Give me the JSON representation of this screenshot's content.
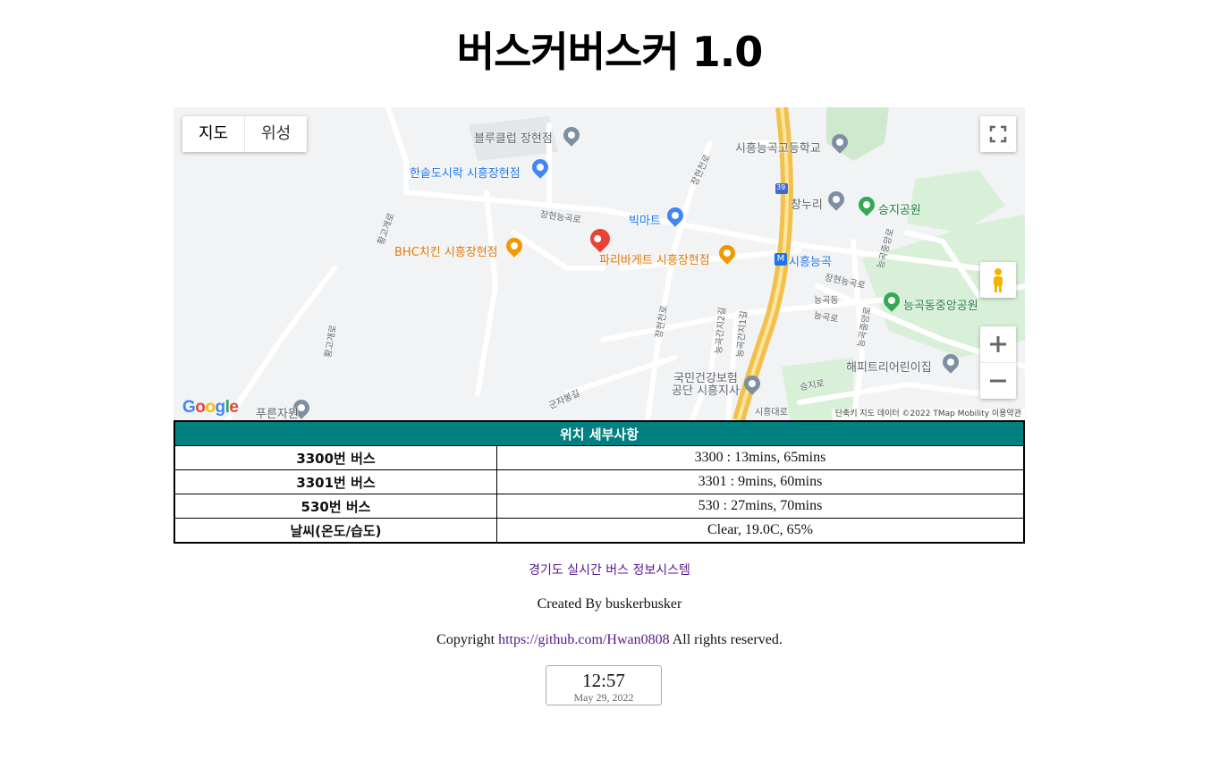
{
  "page": {
    "title": "버스커버스커 1.0"
  },
  "map": {
    "type_controls": {
      "map_label": "지도",
      "satellite_label": "위성"
    },
    "pois": {
      "bluclub": "블루클럽 장현점",
      "hansot": "한솥도시락 시흥장현점",
      "bigmart": "빅마트",
      "bhc": "BHC치킨 시흥장현점",
      "paris": "파리바게트 시흥장현점",
      "station": "시흥능곡",
      "school": "시흥능곡고등학교",
      "changnuri": "창누리",
      "seungji": "승지공원",
      "park": "능곡동중앙공원",
      "happy": "해피트리어린이집",
      "nhis": "국민건강보험 공단 시흥지사",
      "pureun": "푸른자원"
    },
    "roads": {
      "janghyeon_nonggok": "장현능곡로",
      "janghyeon_nonggok_e": "장현능곡로",
      "hwanggo": "황고개로",
      "hwanggo2": "황고개로",
      "janghyeoncheon": "장현천로",
      "janghyeoncheon2": "장현천로",
      "nonggok": "능곡로",
      "nonggokdong": "능곡동",
      "nonggokjungang": "능곡중앙로",
      "nonggokjungang2": "능곡중앙로",
      "nonggokganji2": "능곡간지2길",
      "nonggokganji1": "능곡간지1길",
      "seungji_ro": "승지로",
      "gunja": "군자봉길",
      "sihyeong": "시흥대로",
      "route_shield": "39"
    },
    "branding": "Google",
    "footer": "단축키   지도 데이터 ©2022 TMap Mobility   이용약관"
  },
  "table": {
    "header": "위치 세부사항",
    "rows": [
      {
        "label": "3300번 버스",
        "value": "3300 : 13mins, 65mins"
      },
      {
        "label": "3301번 버스",
        "value": "3301 : 9mins, 60mins"
      },
      {
        "label": "530번 버스",
        "value": "530 : 27mins, 70mins"
      },
      {
        "label": "날씨(온도/습도)",
        "value": "Clear, 19.0C, 65%"
      }
    ]
  },
  "footer": {
    "gbis_link": "경기도 실시간 버스 정보시스템",
    "created_by": "Created By buskerbusker",
    "copyright_prefix": "Copyright",
    "github_link": "https://github.com/Hwan0808",
    "copyright_suffix": "All rights reserved."
  },
  "clock": {
    "time": "12:57",
    "date": "May 29, 2022"
  },
  "colors": {
    "header_bg": "#008080",
    "link": "#551a8b",
    "highway": "#f6c343",
    "pin": "#ea4335"
  }
}
